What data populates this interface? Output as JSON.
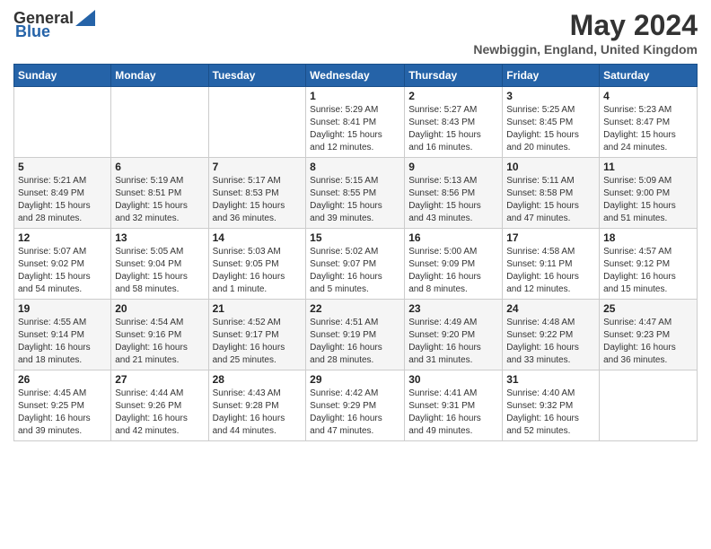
{
  "header": {
    "logo_general": "General",
    "logo_blue": "Blue",
    "month_year": "May 2024",
    "location": "Newbiggin, England, United Kingdom"
  },
  "days_of_week": [
    "Sunday",
    "Monday",
    "Tuesday",
    "Wednesday",
    "Thursday",
    "Friday",
    "Saturday"
  ],
  "weeks": [
    [
      {
        "day": "",
        "info": ""
      },
      {
        "day": "",
        "info": ""
      },
      {
        "day": "",
        "info": ""
      },
      {
        "day": "1",
        "info": "Sunrise: 5:29 AM\nSunset: 8:41 PM\nDaylight: 15 hours\nand 12 minutes."
      },
      {
        "day": "2",
        "info": "Sunrise: 5:27 AM\nSunset: 8:43 PM\nDaylight: 15 hours\nand 16 minutes."
      },
      {
        "day": "3",
        "info": "Sunrise: 5:25 AM\nSunset: 8:45 PM\nDaylight: 15 hours\nand 20 minutes."
      },
      {
        "day": "4",
        "info": "Sunrise: 5:23 AM\nSunset: 8:47 PM\nDaylight: 15 hours\nand 24 minutes."
      }
    ],
    [
      {
        "day": "5",
        "info": "Sunrise: 5:21 AM\nSunset: 8:49 PM\nDaylight: 15 hours\nand 28 minutes."
      },
      {
        "day": "6",
        "info": "Sunrise: 5:19 AM\nSunset: 8:51 PM\nDaylight: 15 hours\nand 32 minutes."
      },
      {
        "day": "7",
        "info": "Sunrise: 5:17 AM\nSunset: 8:53 PM\nDaylight: 15 hours\nand 36 minutes."
      },
      {
        "day": "8",
        "info": "Sunrise: 5:15 AM\nSunset: 8:55 PM\nDaylight: 15 hours\nand 39 minutes."
      },
      {
        "day": "9",
        "info": "Sunrise: 5:13 AM\nSunset: 8:56 PM\nDaylight: 15 hours\nand 43 minutes."
      },
      {
        "day": "10",
        "info": "Sunrise: 5:11 AM\nSunset: 8:58 PM\nDaylight: 15 hours\nand 47 minutes."
      },
      {
        "day": "11",
        "info": "Sunrise: 5:09 AM\nSunset: 9:00 PM\nDaylight: 15 hours\nand 51 minutes."
      }
    ],
    [
      {
        "day": "12",
        "info": "Sunrise: 5:07 AM\nSunset: 9:02 PM\nDaylight: 15 hours\nand 54 minutes."
      },
      {
        "day": "13",
        "info": "Sunrise: 5:05 AM\nSunset: 9:04 PM\nDaylight: 15 hours\nand 58 minutes."
      },
      {
        "day": "14",
        "info": "Sunrise: 5:03 AM\nSunset: 9:05 PM\nDaylight: 16 hours\nand 1 minute."
      },
      {
        "day": "15",
        "info": "Sunrise: 5:02 AM\nSunset: 9:07 PM\nDaylight: 16 hours\nand 5 minutes."
      },
      {
        "day": "16",
        "info": "Sunrise: 5:00 AM\nSunset: 9:09 PM\nDaylight: 16 hours\nand 8 minutes."
      },
      {
        "day": "17",
        "info": "Sunrise: 4:58 AM\nSunset: 9:11 PM\nDaylight: 16 hours\nand 12 minutes."
      },
      {
        "day": "18",
        "info": "Sunrise: 4:57 AM\nSunset: 9:12 PM\nDaylight: 16 hours\nand 15 minutes."
      }
    ],
    [
      {
        "day": "19",
        "info": "Sunrise: 4:55 AM\nSunset: 9:14 PM\nDaylight: 16 hours\nand 18 minutes."
      },
      {
        "day": "20",
        "info": "Sunrise: 4:54 AM\nSunset: 9:16 PM\nDaylight: 16 hours\nand 21 minutes."
      },
      {
        "day": "21",
        "info": "Sunrise: 4:52 AM\nSunset: 9:17 PM\nDaylight: 16 hours\nand 25 minutes."
      },
      {
        "day": "22",
        "info": "Sunrise: 4:51 AM\nSunset: 9:19 PM\nDaylight: 16 hours\nand 28 minutes."
      },
      {
        "day": "23",
        "info": "Sunrise: 4:49 AM\nSunset: 9:20 PM\nDaylight: 16 hours\nand 31 minutes."
      },
      {
        "day": "24",
        "info": "Sunrise: 4:48 AM\nSunset: 9:22 PM\nDaylight: 16 hours\nand 33 minutes."
      },
      {
        "day": "25",
        "info": "Sunrise: 4:47 AM\nSunset: 9:23 PM\nDaylight: 16 hours\nand 36 minutes."
      }
    ],
    [
      {
        "day": "26",
        "info": "Sunrise: 4:45 AM\nSunset: 9:25 PM\nDaylight: 16 hours\nand 39 minutes."
      },
      {
        "day": "27",
        "info": "Sunrise: 4:44 AM\nSunset: 9:26 PM\nDaylight: 16 hours\nand 42 minutes."
      },
      {
        "day": "28",
        "info": "Sunrise: 4:43 AM\nSunset: 9:28 PM\nDaylight: 16 hours\nand 44 minutes."
      },
      {
        "day": "29",
        "info": "Sunrise: 4:42 AM\nSunset: 9:29 PM\nDaylight: 16 hours\nand 47 minutes."
      },
      {
        "day": "30",
        "info": "Sunrise: 4:41 AM\nSunset: 9:31 PM\nDaylight: 16 hours\nand 49 minutes."
      },
      {
        "day": "31",
        "info": "Sunrise: 4:40 AM\nSunset: 9:32 PM\nDaylight: 16 hours\nand 52 minutes."
      },
      {
        "day": "",
        "info": ""
      }
    ]
  ]
}
